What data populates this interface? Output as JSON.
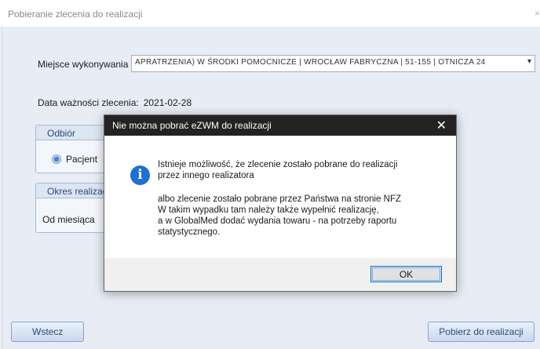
{
  "window": {
    "title": "Pobieranie zlecenia do realizacji",
    "close": "×"
  },
  "form": {
    "place_label": "Miejsce wykonywania",
    "place_value": "APRATRZENIA) W ŚRODKI POMOCNICZE | WROCŁAW FABRYCZNA | 51-155 | OTNICZA 24",
    "place_arrow": "▾",
    "validity_label": "Data ważności zlecenia:",
    "validity_value": "2021-02-28",
    "pickup_group": "Odbiór",
    "pickup_option": "Pacjent",
    "period_group": "Okres realizacji",
    "from_month": "Od miesiąca"
  },
  "buttons": {
    "back": "Wstecz",
    "fetch": "Pobierz do realizacji"
  },
  "dialog": {
    "title": "Nie można pobrać eZWM do realizacji",
    "close": "✕",
    "icon": "info-icon",
    "line1": "Istnieje możliwość, że zlecenie zostało pobrane do realizacji",
    "line2": "przez innego realizatora",
    "line3": "albo zlecenie zostało pobrane przez Państwa na stronie NFZ",
    "line4": "W takim wypadku tam należy także wypełnić realizację,",
    "line5": "a w GlobalMed dodać wydania towaru - na potrzeby raportu",
    "line6": "statystycznego.",
    "ok": "OK"
  },
  "colors": {
    "accent": "#1e6fd6",
    "dialog_titlebar": "#232323",
    "background": "#e7ecf5"
  }
}
